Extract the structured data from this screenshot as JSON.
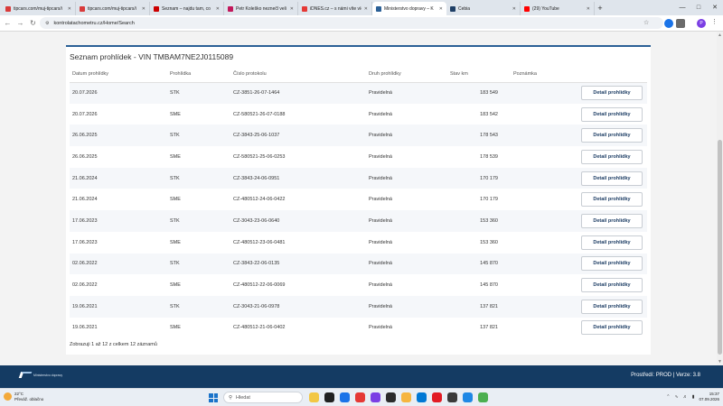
{
  "browser": {
    "tabs": [
      {
        "label": "tipcars.com/muj-tipcars/i",
        "favicon_color": "#d93b3b",
        "active": false
      },
      {
        "label": "tipcars.com/muj-tipcars/i",
        "favicon_color": "#d93b3b",
        "active": false
      },
      {
        "label": "Seznam – najdu tam, co",
        "favicon_color": "#cc0000",
        "active": false
      },
      {
        "label": "Petr Koleško neznečl veli",
        "favicon_color": "#c2185b",
        "active": false
      },
      {
        "label": "iDNES.cz – s námi víte víc",
        "favicon_color": "#e53935",
        "active": false
      },
      {
        "label": "Ministerstvo dopravy – K",
        "favicon_color": "#2b6096",
        "active": true
      },
      {
        "label": "Cebia",
        "favicon_color": "#1f3f66",
        "active": false
      },
      {
        "label": "(29) YouTube",
        "favicon_color": "#ff0000",
        "active": false
      }
    ],
    "new_tab": "+",
    "url": "kontrolatachometru.cz/Home/Search",
    "profile_initial": "P"
  },
  "page": {
    "title": "Seznam prohlídek - VIN TMBAM7NE2J0115089",
    "columns": [
      "Datum prohlídky",
      "Prohlídka",
      "Číslo protokolu",
      "Druh prohlídky",
      "Stav km",
      "Poznámka"
    ],
    "button_label": "Detail prohlídky",
    "rows": [
      {
        "date": "20.07.2026",
        "type": "STK",
        "protocol": "CZ-3851-26-07-1464",
        "kind": "Pravidelná",
        "km": "183 549",
        "note": ""
      },
      {
        "date": "20.07.2026",
        "type": "SME",
        "protocol": "CZ-580521-26-07-0188",
        "kind": "Pravidelná",
        "km": "183 542",
        "note": ""
      },
      {
        "date": "26.06.2025",
        "type": "STK",
        "protocol": "CZ-3843-25-06-1037",
        "kind": "Pravidelná",
        "km": "178 543",
        "note": ""
      },
      {
        "date": "26.06.2025",
        "type": "SME",
        "protocol": "CZ-580521-25-06-0253",
        "kind": "Pravidelná",
        "km": "178 539",
        "note": ""
      },
      {
        "date": "21.06.2024",
        "type": "STK",
        "protocol": "CZ-3843-24-06-0951",
        "kind": "Pravidelná",
        "km": "170 179",
        "note": ""
      },
      {
        "date": "21.06.2024",
        "type": "SME",
        "protocol": "CZ-480512-24-06-0422",
        "kind": "Pravidelná",
        "km": "170 179",
        "note": ""
      },
      {
        "date": "17.06.2023",
        "type": "STK",
        "protocol": "CZ-3043-23-06-0640",
        "kind": "Pravidelná",
        "km": "153 360",
        "note": ""
      },
      {
        "date": "17.06.2023",
        "type": "SME",
        "protocol": "CZ-480512-23-06-0481",
        "kind": "Pravidelná",
        "km": "153 360",
        "note": ""
      },
      {
        "date": "02.06.2022",
        "type": "STK",
        "protocol": "CZ-3843-22-06-0135",
        "kind": "Pravidelná",
        "km": "145 870",
        "note": ""
      },
      {
        "date": "02.06.2022",
        "type": "SME",
        "protocol": "CZ-480512-22-06-0069",
        "kind": "Pravidelná",
        "km": "145 870",
        "note": ""
      },
      {
        "date": "19.06.2021",
        "type": "STK",
        "protocol": "CZ-3043-21-06-0978",
        "kind": "Pravidelná",
        "km": "137 821",
        "note": ""
      },
      {
        "date": "19.06.2021",
        "type": "SME",
        "protocol": "CZ-480512-21-06-0402",
        "kind": "Pravidelná",
        "km": "137 821",
        "note": ""
      }
    ],
    "summary": "Zobrazuji 1 až 12 z celkem 12 záznamů"
  },
  "footer": {
    "logo_text": "Ministerstvo dopravy",
    "env": "Prostředí: PROD | Verze: 3.8",
    "colors": {
      "bar": "#143b63",
      "accent": "#2b6096"
    }
  },
  "taskbar": {
    "weather_temp": "22°C",
    "weather_desc": "Převáž. oblačno",
    "search_placeholder": "Hledat",
    "time": "15:37",
    "date": "07.09.2026",
    "app_icon_colors": [
      "#f2c744",
      "#202020",
      "#1a73e8",
      "#e53935",
      "#7b3fe4",
      "#2b2b2b",
      "#f6b53f",
      "#0078d4",
      "#e21b24",
      "#3a3a3a",
      "#1e88e5",
      "#4caf50"
    ]
  }
}
